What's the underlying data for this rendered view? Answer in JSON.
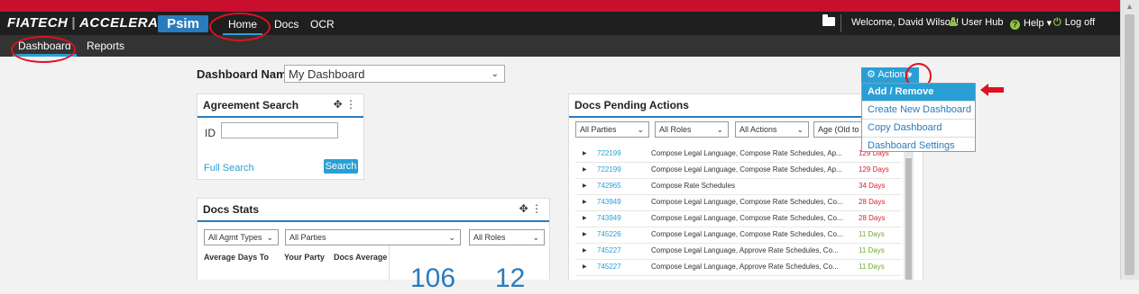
{
  "brand": {
    "name": "FIATECH",
    "product": "ACCELERATE",
    "app": "Psim"
  },
  "topnav": {
    "links": [
      "Home",
      "Docs",
      "OCR"
    ],
    "active": "Home"
  },
  "usernav": {
    "welcome": "Welcome, David Wilson!",
    "user_hub": "User Hub",
    "help": "Help",
    "logoff": "Log off"
  },
  "subnav": {
    "items": [
      "Dashboard",
      "Reports"
    ],
    "active": "Dashboard"
  },
  "dashboard": {
    "name_label": "Dashboard Name",
    "selected": "My Dashboard"
  },
  "actions": {
    "label": "Actions",
    "menu": [
      "Add / Remove Widgets",
      "Create New Dashboard",
      "Copy Dashboard",
      "Dashboard Settings"
    ],
    "highlighted": "Add / Remove Widgets"
  },
  "agreement_search": {
    "title": "Agreement Search",
    "id_label": "ID",
    "id_value": "",
    "full_search": "Full Search",
    "search_button": "Search"
  },
  "docs_stats": {
    "title": "Docs Stats",
    "filters": [
      "All Agmt Types",
      "All Parties",
      "All Roles"
    ],
    "col_avg_days": "Average Days To",
    "col_your_party": "Your Party",
    "col_docs_avg": "Docs Average",
    "big_values": [
      "106",
      "12"
    ]
  },
  "docs_pending": {
    "title": "Docs Pending Actions",
    "filters": [
      "All Parties",
      "All Roles",
      "All Actions",
      "Age (Old to N"
    ],
    "rows": [
      {
        "id": "722199",
        "desc": "Compose Legal Language, Compose Rate Schedules, Ap...",
        "days": "129 Days",
        "color": "#d9232d"
      },
      {
        "id": "722199",
        "desc": "Compose Legal Language, Compose Rate Schedules, Ap...",
        "days": "129 Days",
        "color": "#d9232d"
      },
      {
        "id": "742965",
        "desc": "Compose Rate Schedules",
        "days": "34 Days",
        "color": "#d9232d"
      },
      {
        "id": "743949",
        "desc": "Compose Legal Language, Compose Rate Schedules, Co...",
        "days": "28 Days",
        "color": "#d9232d"
      },
      {
        "id": "743949",
        "desc": "Compose Legal Language, Compose Rate Schedules, Co...",
        "days": "28 Days",
        "color": "#d9232d"
      },
      {
        "id": "745226",
        "desc": "Compose Legal Language, Compose Rate Schedules, Co...",
        "days": "11 Days",
        "color": "#6bab2f"
      },
      {
        "id": "745227",
        "desc": "Compose Legal Language, Approve Rate Schedules, Co...",
        "days": "11 Days",
        "color": "#6bab2f"
      },
      {
        "id": "745227",
        "desc": "Compose Legal Language, Approve Rate Schedules, Co...",
        "days": "11 Days",
        "color": "#6bab2f"
      }
    ]
  },
  "colors": {
    "accent": "#2a9fd6",
    "brand_red": "#c8102e",
    "nav_bg": "#1f1f1f"
  }
}
